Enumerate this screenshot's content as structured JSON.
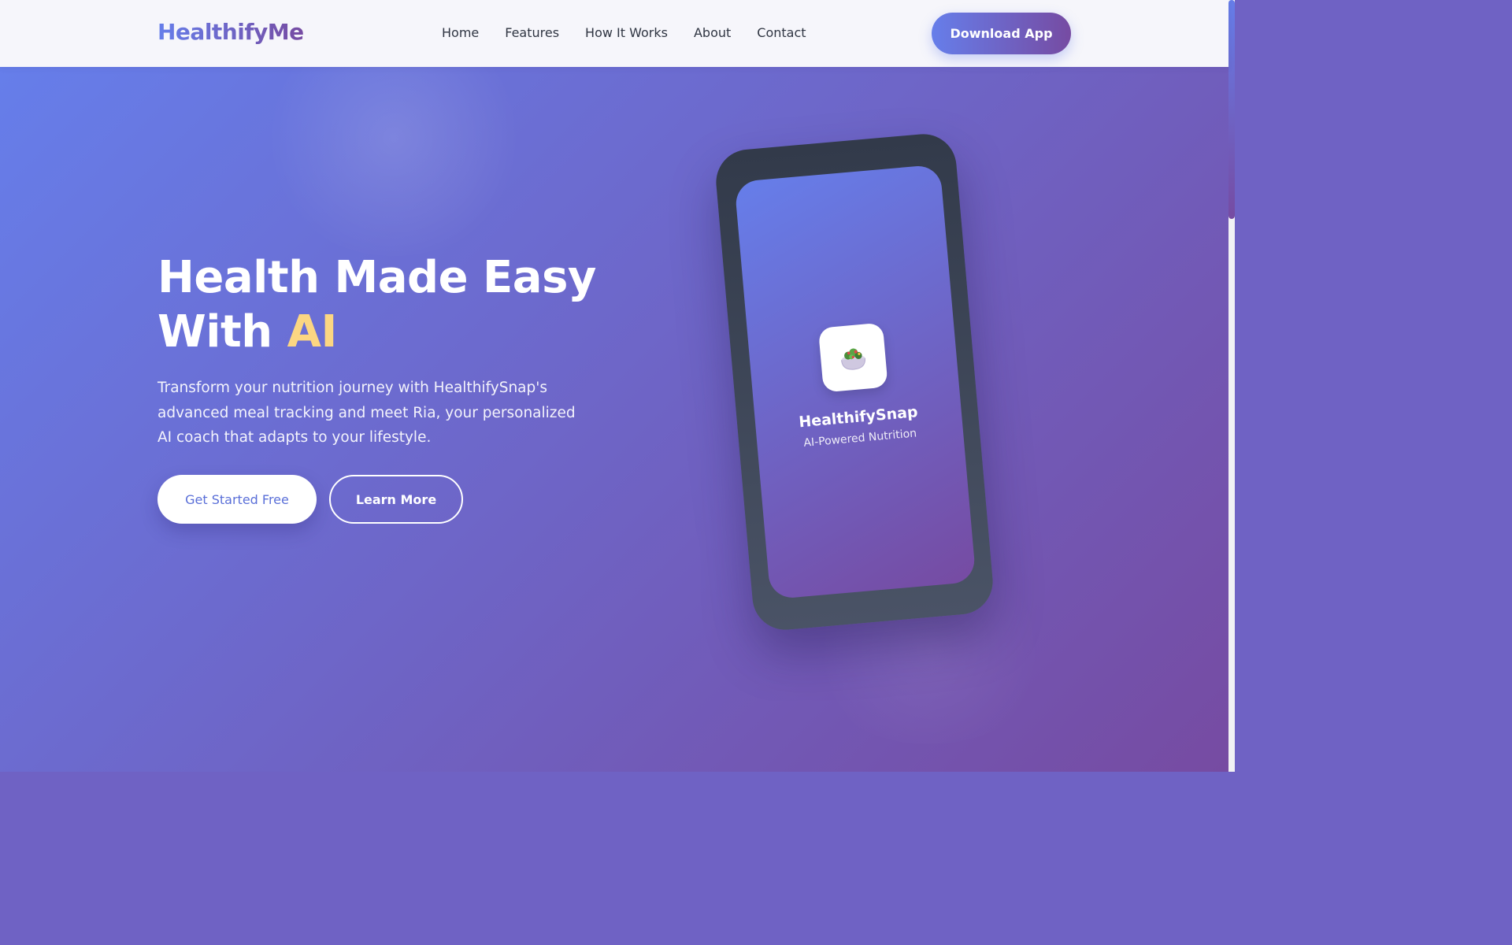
{
  "nav": {
    "logo": "HealthifyMe",
    "links": [
      "Home",
      "Features",
      "How It Works",
      "About",
      "Contact"
    ],
    "cta": "Download App"
  },
  "hero": {
    "title_line1": "Health Made Easy",
    "title_line2_prefix": "With ",
    "title_accent": "AI",
    "description": "Transform your nutrition journey with HealthifySnap's advanced meal tracking and meet Ria, your personalized AI coach that adapts to your lifestyle.",
    "primary_button": "Get Started Free",
    "secondary_button": "Learn More"
  },
  "phone": {
    "icon": "salad-bowl-icon",
    "app_name": "HealthifySnap",
    "tagline": "AI-Powered Nutrition"
  },
  "colors": {
    "gradient_start": "#667eea",
    "gradient_end": "#764ba2",
    "accent_yellow": "#fcd682",
    "nav_background": "#f6f6fb"
  }
}
